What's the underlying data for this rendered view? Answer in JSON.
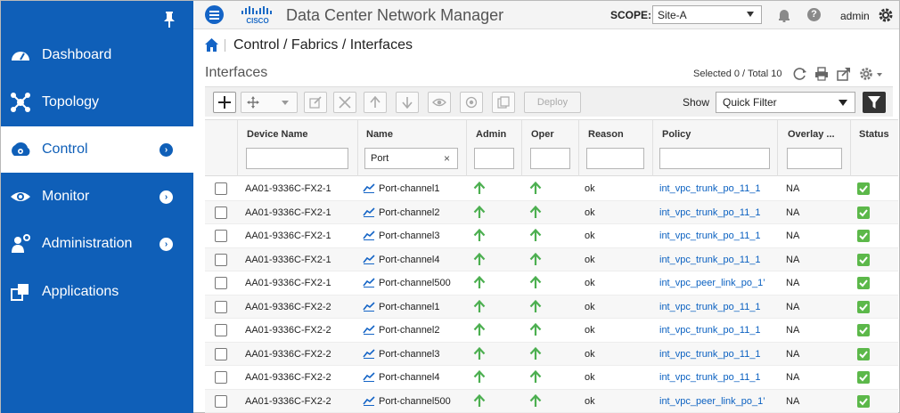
{
  "sidebar": {
    "items": [
      {
        "label": "Dashboard",
        "icon": "dashboard-icon"
      },
      {
        "label": "Topology",
        "icon": "topology-icon"
      },
      {
        "label": "Control",
        "icon": "control-icon",
        "active": true
      },
      {
        "label": "Monitor",
        "icon": "monitor-icon"
      },
      {
        "label": "Administration",
        "icon": "administration-icon"
      },
      {
        "label": "Applications",
        "icon": "applications-icon"
      }
    ],
    "chevron": "›"
  },
  "topbar": {
    "title": "Data Center Network Manager",
    "scope_label": "SCOPE:",
    "scope_value": "Site-A",
    "help": "?",
    "user": "admin"
  },
  "breadcrumb": "Control / Fabrics / Interfaces",
  "page_title": "Interfaces",
  "selection_status": "Selected 0 / Total 10",
  "toolbar": {
    "deploy_label": "Deploy",
    "show_label": "Show",
    "filter_value": "Quick Filter"
  },
  "table": {
    "columns": [
      "Device Name",
      "Name",
      "Admin",
      "Oper",
      "Reason",
      "Policy",
      "Overlay ...",
      "Status"
    ],
    "name_filter": "Port",
    "clear_filter": "×",
    "rows": [
      {
        "device": "AA01-9336C-FX2-1",
        "name": "Port-channel1",
        "reason": "ok",
        "policy": "int_vpc_trunk_po_11_1",
        "overlay": "NA"
      },
      {
        "device": "AA01-9336C-FX2-1",
        "name": "Port-channel2",
        "reason": "ok",
        "policy": "int_vpc_trunk_po_11_1",
        "overlay": "NA"
      },
      {
        "device": "AA01-9336C-FX2-1",
        "name": "Port-channel3",
        "reason": "ok",
        "policy": "int_vpc_trunk_po_11_1",
        "overlay": "NA"
      },
      {
        "device": "AA01-9336C-FX2-1",
        "name": "Port-channel4",
        "reason": "ok",
        "policy": "int_vpc_trunk_po_11_1",
        "overlay": "NA"
      },
      {
        "device": "AA01-9336C-FX2-1",
        "name": "Port-channel500",
        "reason": "ok",
        "policy": "int_vpc_peer_link_po_1’",
        "overlay": "NA"
      },
      {
        "device": "AA01-9336C-FX2-2",
        "name": "Port-channel1",
        "reason": "ok",
        "policy": "int_vpc_trunk_po_11_1",
        "overlay": "NA"
      },
      {
        "device": "AA01-9336C-FX2-2",
        "name": "Port-channel2",
        "reason": "ok",
        "policy": "int_vpc_trunk_po_11_1",
        "overlay": "NA"
      },
      {
        "device": "AA01-9336C-FX2-2",
        "name": "Port-channel3",
        "reason": "ok",
        "policy": "int_vpc_trunk_po_11_1",
        "overlay": "NA"
      },
      {
        "device": "AA01-9336C-FX2-2",
        "name": "Port-channel4",
        "reason": "ok",
        "policy": "int_vpc_trunk_po_11_1",
        "overlay": "NA"
      },
      {
        "device": "AA01-9336C-FX2-2",
        "name": "Port-channel500",
        "reason": "ok",
        "policy": "int_vpc_peer_link_po_1’",
        "overlay": "NA"
      }
    ]
  },
  "colors": {
    "sidebar_bg": "#0f5fb8",
    "link": "#0b61c1",
    "up_arrow": "#4caf50",
    "status_ok": "#5cb84a"
  }
}
